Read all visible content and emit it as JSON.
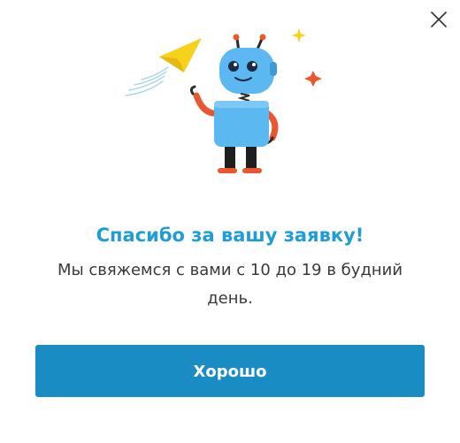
{
  "dialog": {
    "title": "Спасибо за вашу заявку!",
    "message": "Мы свяжемся с вами с 10 до 19 в будний день.",
    "ok_label": "Хорошо"
  },
  "icons": {
    "close": "close-icon",
    "illustration": "robot-paper-plane-illustration"
  },
  "colors": {
    "title": "#1f9ed6",
    "button_bg": "#1a8cc4",
    "button_text": "#ffffff",
    "message_text": "#3a3a3a",
    "robot_body": "#5bb8f0",
    "robot_arms": "#e8572f",
    "paper_plane": "#f7d21c"
  }
}
